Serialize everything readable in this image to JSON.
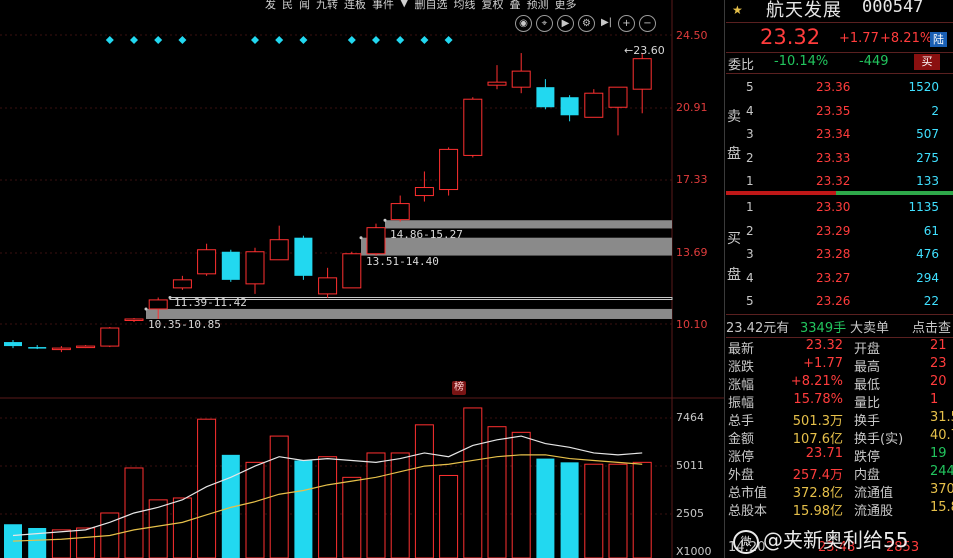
{
  "toolbar": {
    "items": [
      "发",
      "民",
      "闻",
      "九转",
      "连板",
      "事件",
      "▼",
      "删自选",
      "均线",
      "复权",
      "叠",
      "预测",
      "更多"
    ],
    "icons": [
      "eye-icon",
      "screenshot-icon",
      "play-icon",
      "gear-icon",
      "last-icon",
      "zoom-in-icon",
      "zoom-out-icon"
    ]
  },
  "chart_data": {
    "type": "candlestick",
    "price_axis_labels": [
      "24.50",
      "20.91",
      "17.33",
      "13.69",
      "10.10"
    ],
    "price_annotation": "←23.60",
    "volume_axis_labels": [
      "7464",
      "5011",
      "2505",
      "X1000"
    ],
    "zones": [
      {
        "label": "14.86-15.27",
        "low": 14.86,
        "high": 15.27
      },
      {
        "label": "13.51-14.40",
        "low": 13.51,
        "high": 14.4
      },
      {
        "label": "11.39-11.42",
        "low": 11.39,
        "high": 11.42
      },
      {
        "label": "10.35-10.85",
        "low": 10.35,
        "high": 10.85
      }
    ],
    "candles": [
      {
        "o": 9.2,
        "c": 9.0,
        "h": 9.3,
        "l": 8.9
      },
      {
        "o": 8.95,
        "c": 8.9,
        "h": 9.05,
        "l": 8.85
      },
      {
        "o": 8.85,
        "c": 8.9,
        "h": 9.0,
        "l": 8.7
      },
      {
        "o": 8.95,
        "c": 9.0,
        "h": 9.05,
        "l": 8.9
      },
      {
        "o": 9.0,
        "c": 9.9,
        "h": 9.95,
        "l": 8.95
      },
      {
        "o": 10.3,
        "c": 10.35,
        "h": 10.4,
        "l": 10.2
      },
      {
        "o": 10.85,
        "c": 11.3,
        "h": 11.42,
        "l": 10.35
      },
      {
        "o": 11.9,
        "c": 12.3,
        "h": 12.5,
        "l": 11.8
      },
      {
        "o": 12.6,
        "c": 13.8,
        "h": 14.1,
        "l": 12.5
      },
      {
        "o": 13.7,
        "c": 12.3,
        "h": 13.8,
        "l": 12.2
      },
      {
        "o": 12.1,
        "c": 13.7,
        "h": 13.9,
        "l": 11.6
      },
      {
        "o": 13.3,
        "c": 14.3,
        "h": 15.0,
        "l": 13.3
      },
      {
        "o": 14.4,
        "c": 12.5,
        "h": 14.5,
        "l": 12.3
      },
      {
        "o": 11.6,
        "c": 12.4,
        "h": 12.9,
        "l": 11.4
      },
      {
        "o": 11.9,
        "c": 13.6,
        "h": 13.7,
        "l": 11.9
      },
      {
        "o": 13.6,
        "c": 14.9,
        "h": 15.1,
        "l": 13.5
      },
      {
        "o": 15.3,
        "c": 16.1,
        "h": 16.5,
        "l": 15.2
      },
      {
        "o": 16.5,
        "c": 16.9,
        "h": 17.7,
        "l": 16.2
      },
      {
        "o": 16.8,
        "c": 18.8,
        "h": 18.9,
        "l": 16.5
      },
      {
        "o": 18.5,
        "c": 21.3,
        "h": 21.4,
        "l": 18.4
      },
      {
        "o": 22.0,
        "c": 22.15,
        "h": 23.0,
        "l": 21.8
      },
      {
        "o": 21.9,
        "c": 22.7,
        "h": 23.6,
        "l": 21.6
      },
      {
        "o": 21.9,
        "c": 20.9,
        "h": 22.3,
        "l": 20.8
      },
      {
        "o": 21.4,
        "c": 20.5,
        "h": 21.5,
        "l": 20.2
      },
      {
        "o": 20.4,
        "c": 21.6,
        "h": 21.8,
        "l": 20.4
      },
      {
        "o": 20.9,
        "c": 21.9,
        "h": 21.9,
        "l": 19.5
      },
      {
        "o": 21.8,
        "c": 23.32,
        "h": 23.6,
        "l": 20.6
      }
    ],
    "volumes": [
      1800,
      1600,
      1500,
      1600,
      2400,
      4800,
      3100,
      3200,
      7400,
      5500,
      5100,
      6500,
      5200,
      5400,
      4300,
      5600,
      5600,
      7100,
      4400,
      8000,
      7000,
      6700,
      5300,
      5100,
      5000,
      5000,
      5100
    ],
    "ma_short": [
      1200,
      1300,
      1400,
      1500,
      1900,
      2400,
      2700,
      3100,
      3800,
      4300,
      4900,
      5400,
      5200,
      5300,
      5200,
      5100,
      5300,
      5600,
      5400,
      6000,
      6300,
      6500,
      6100,
      5900,
      5600,
      5500,
      5600
    ],
    "ma_long": [
      900,
      950,
      1000,
      1100,
      1200,
      1500,
      1700,
      1900,
      2300,
      2700,
      3000,
      3400,
      3600,
      3900,
      4100,
      4300,
      4600,
      4900,
      5000,
      5200,
      5400,
      5500,
      5500,
      5300,
      5200,
      5100,
      5000
    ],
    "signal_markers": [
      4,
      5,
      6,
      7,
      10,
      11,
      12,
      14,
      15,
      16,
      17,
      18
    ]
  },
  "panel": {
    "stock_name": "航天发展",
    "stock_code": "000547",
    "price": "23.32",
    "change": "+1.77",
    "change_pct": "+8.21%",
    "market_badge": "陆",
    "weibi_label": "委比",
    "weibi_pct": "-10.14%",
    "weicha": "-449",
    "buy_button": "买",
    "sell_label": [
      "卖",
      "盘"
    ],
    "buy_label": [
      "买",
      "盘"
    ],
    "asks": [
      {
        "level": "5",
        "price": "23.36",
        "vol": "1520"
      },
      {
        "level": "4",
        "price": "23.35",
        "vol": "2"
      },
      {
        "level": "3",
        "price": "23.34",
        "vol": "507"
      },
      {
        "level": "2",
        "price": "23.33",
        "vol": "275"
      },
      {
        "level": "1",
        "price": "23.32",
        "vol": "133"
      }
    ],
    "bids": [
      {
        "level": "1",
        "price": "23.30",
        "vol": "1135"
      },
      {
        "level": "2",
        "price": "23.29",
        "vol": "61"
      },
      {
        "level": "3",
        "price": "23.28",
        "vol": "476"
      },
      {
        "level": "4",
        "price": "23.27",
        "vol": "294"
      },
      {
        "level": "5",
        "price": "23.26",
        "vol": "22"
      }
    ],
    "trade_row": {
      "amount": "23.42元有",
      "hands": "3349手",
      "big": "大卖单",
      "link": "点击查"
    },
    "stats": [
      {
        "k": "最新",
        "v": "23.32",
        "vc": "#ff3c3c",
        "k2": "开盘",
        "v2": "21",
        "v2c": "#ff3c3c"
      },
      {
        "k": "涨跌",
        "v": "+1.77",
        "vc": "#ff3c3c",
        "k2": "最高",
        "v2": "23",
        "v2c": "#ff3c3c"
      },
      {
        "k": "涨幅",
        "v": "+8.21%",
        "vc": "#ff3c3c",
        "k2": "最低",
        "v2": "20",
        "v2c": "#ff3c3c"
      },
      {
        "k": "振幅",
        "v": "15.78%",
        "vc": "#ff3c3c",
        "k2": "量比",
        "v2": "1",
        "v2c": "#ff3c3c"
      },
      {
        "k": "总手",
        "v": "501.3万",
        "vc": "#e6c04a",
        "k2": "换手",
        "v2": "31.5",
        "v2c": "#e6c04a"
      },
      {
        "k": "金额",
        "v": "107.6亿",
        "vc": "#e6c04a",
        "k2": "换手(实)",
        "v2": "40.7",
        "v2c": "#e6c04a"
      },
      {
        "k": "涨停",
        "v": "23.71",
        "vc": "#ff3c3c",
        "k2": "跌停",
        "v2": "19",
        "v2c": "#22c55e"
      },
      {
        "k": "外盘",
        "v": "257.4万",
        "vc": "#ff3c3c",
        "k2": "内盘",
        "v2": "244.",
        "v2c": "#22c55e"
      },
      {
        "k": "总市值",
        "v": "372.8亿",
        "vc": "#e6c04a",
        "k2": "流通值",
        "v2": "370.",
        "v2c": "#e6c04a"
      },
      {
        "k": "总股本",
        "v": "15.98亿",
        "vc": "#e6c04a",
        "k2": "流通股",
        "v2": "15.8",
        "v2c": "#e6c04a"
      }
    ],
    "time": "14:20",
    "time_price": "23.48",
    "time_vol": "2853"
  },
  "chart_badge": "榜",
  "watermark": "@夹新奥利给55"
}
